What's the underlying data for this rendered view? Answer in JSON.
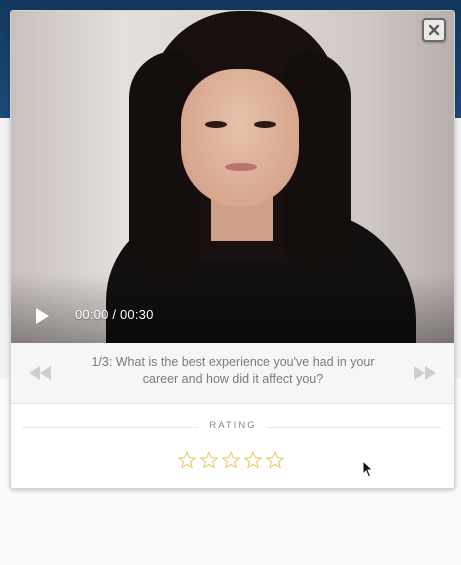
{
  "video": {
    "time_display": "00:00 / 00:30",
    "current_time": "00:00",
    "duration": "00:30"
  },
  "question": {
    "text": "1/3: What is the best experience you've had in your career and how did it affect you?"
  },
  "rating": {
    "label": "RATING",
    "max_stars": 5,
    "value": 0
  },
  "colors": {
    "star_outline": "#e8c766",
    "page_header": "#1b4a78",
    "nav_arrow": "#cfcfcf",
    "question_text": "#7b7b7b"
  },
  "icons": {
    "close": "close-icon",
    "play": "play-icon",
    "prev": "rewind-icon",
    "next": "fast-forward-icon",
    "star": "star-outline-icon",
    "cursor": "mouse-cursor-icon"
  }
}
